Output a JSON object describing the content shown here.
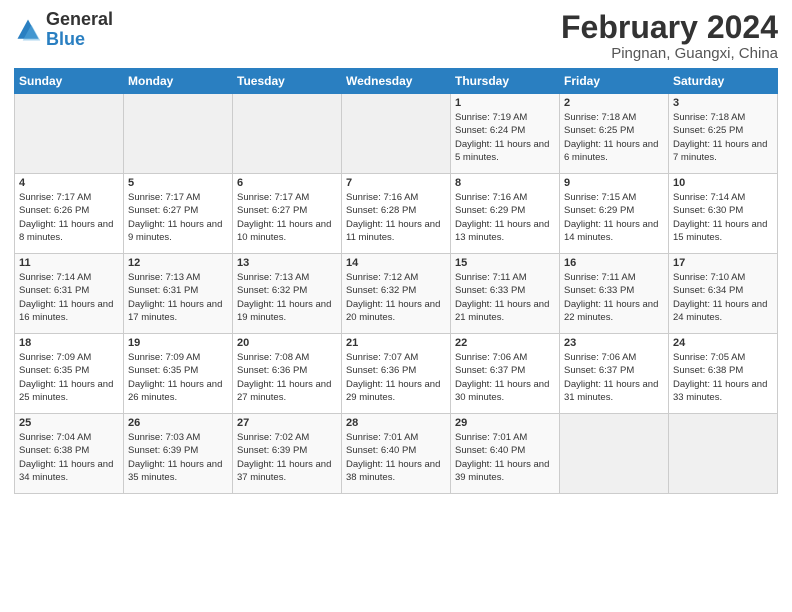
{
  "logo": {
    "general": "General",
    "blue": "Blue"
  },
  "title": "February 2024",
  "subtitle": "Pingnan, Guangxi, China",
  "days_of_week": [
    "Sunday",
    "Monday",
    "Tuesday",
    "Wednesday",
    "Thursday",
    "Friday",
    "Saturday"
  ],
  "weeks": [
    [
      {
        "day": "",
        "info": ""
      },
      {
        "day": "",
        "info": ""
      },
      {
        "day": "",
        "info": ""
      },
      {
        "day": "",
        "info": ""
      },
      {
        "day": "1",
        "info": "Sunrise: 7:19 AM\nSunset: 6:24 PM\nDaylight: 11 hours and 5 minutes."
      },
      {
        "day": "2",
        "info": "Sunrise: 7:18 AM\nSunset: 6:25 PM\nDaylight: 11 hours and 6 minutes."
      },
      {
        "day": "3",
        "info": "Sunrise: 7:18 AM\nSunset: 6:25 PM\nDaylight: 11 hours and 7 minutes."
      }
    ],
    [
      {
        "day": "4",
        "info": "Sunrise: 7:17 AM\nSunset: 6:26 PM\nDaylight: 11 hours and 8 minutes."
      },
      {
        "day": "5",
        "info": "Sunrise: 7:17 AM\nSunset: 6:27 PM\nDaylight: 11 hours and 9 minutes."
      },
      {
        "day": "6",
        "info": "Sunrise: 7:17 AM\nSunset: 6:27 PM\nDaylight: 11 hours and 10 minutes."
      },
      {
        "day": "7",
        "info": "Sunrise: 7:16 AM\nSunset: 6:28 PM\nDaylight: 11 hours and 11 minutes."
      },
      {
        "day": "8",
        "info": "Sunrise: 7:16 AM\nSunset: 6:29 PM\nDaylight: 11 hours and 13 minutes."
      },
      {
        "day": "9",
        "info": "Sunrise: 7:15 AM\nSunset: 6:29 PM\nDaylight: 11 hours and 14 minutes."
      },
      {
        "day": "10",
        "info": "Sunrise: 7:14 AM\nSunset: 6:30 PM\nDaylight: 11 hours and 15 minutes."
      }
    ],
    [
      {
        "day": "11",
        "info": "Sunrise: 7:14 AM\nSunset: 6:31 PM\nDaylight: 11 hours and 16 minutes."
      },
      {
        "day": "12",
        "info": "Sunrise: 7:13 AM\nSunset: 6:31 PM\nDaylight: 11 hours and 17 minutes."
      },
      {
        "day": "13",
        "info": "Sunrise: 7:13 AM\nSunset: 6:32 PM\nDaylight: 11 hours and 19 minutes."
      },
      {
        "day": "14",
        "info": "Sunrise: 7:12 AM\nSunset: 6:32 PM\nDaylight: 11 hours and 20 minutes."
      },
      {
        "day": "15",
        "info": "Sunrise: 7:11 AM\nSunset: 6:33 PM\nDaylight: 11 hours and 21 minutes."
      },
      {
        "day": "16",
        "info": "Sunrise: 7:11 AM\nSunset: 6:33 PM\nDaylight: 11 hours and 22 minutes."
      },
      {
        "day": "17",
        "info": "Sunrise: 7:10 AM\nSunset: 6:34 PM\nDaylight: 11 hours and 24 minutes."
      }
    ],
    [
      {
        "day": "18",
        "info": "Sunrise: 7:09 AM\nSunset: 6:35 PM\nDaylight: 11 hours and 25 minutes."
      },
      {
        "day": "19",
        "info": "Sunrise: 7:09 AM\nSunset: 6:35 PM\nDaylight: 11 hours and 26 minutes."
      },
      {
        "day": "20",
        "info": "Sunrise: 7:08 AM\nSunset: 6:36 PM\nDaylight: 11 hours and 27 minutes."
      },
      {
        "day": "21",
        "info": "Sunrise: 7:07 AM\nSunset: 6:36 PM\nDaylight: 11 hours and 29 minutes."
      },
      {
        "day": "22",
        "info": "Sunrise: 7:06 AM\nSunset: 6:37 PM\nDaylight: 11 hours and 30 minutes."
      },
      {
        "day": "23",
        "info": "Sunrise: 7:06 AM\nSunset: 6:37 PM\nDaylight: 11 hours and 31 minutes."
      },
      {
        "day": "24",
        "info": "Sunrise: 7:05 AM\nSunset: 6:38 PM\nDaylight: 11 hours and 33 minutes."
      }
    ],
    [
      {
        "day": "25",
        "info": "Sunrise: 7:04 AM\nSunset: 6:38 PM\nDaylight: 11 hours and 34 minutes."
      },
      {
        "day": "26",
        "info": "Sunrise: 7:03 AM\nSunset: 6:39 PM\nDaylight: 11 hours and 35 minutes."
      },
      {
        "day": "27",
        "info": "Sunrise: 7:02 AM\nSunset: 6:39 PM\nDaylight: 11 hours and 37 minutes."
      },
      {
        "day": "28",
        "info": "Sunrise: 7:01 AM\nSunset: 6:40 PM\nDaylight: 11 hours and 38 minutes."
      },
      {
        "day": "29",
        "info": "Sunrise: 7:01 AM\nSunset: 6:40 PM\nDaylight: 11 hours and 39 minutes."
      },
      {
        "day": "",
        "info": ""
      },
      {
        "day": "",
        "info": ""
      }
    ]
  ]
}
